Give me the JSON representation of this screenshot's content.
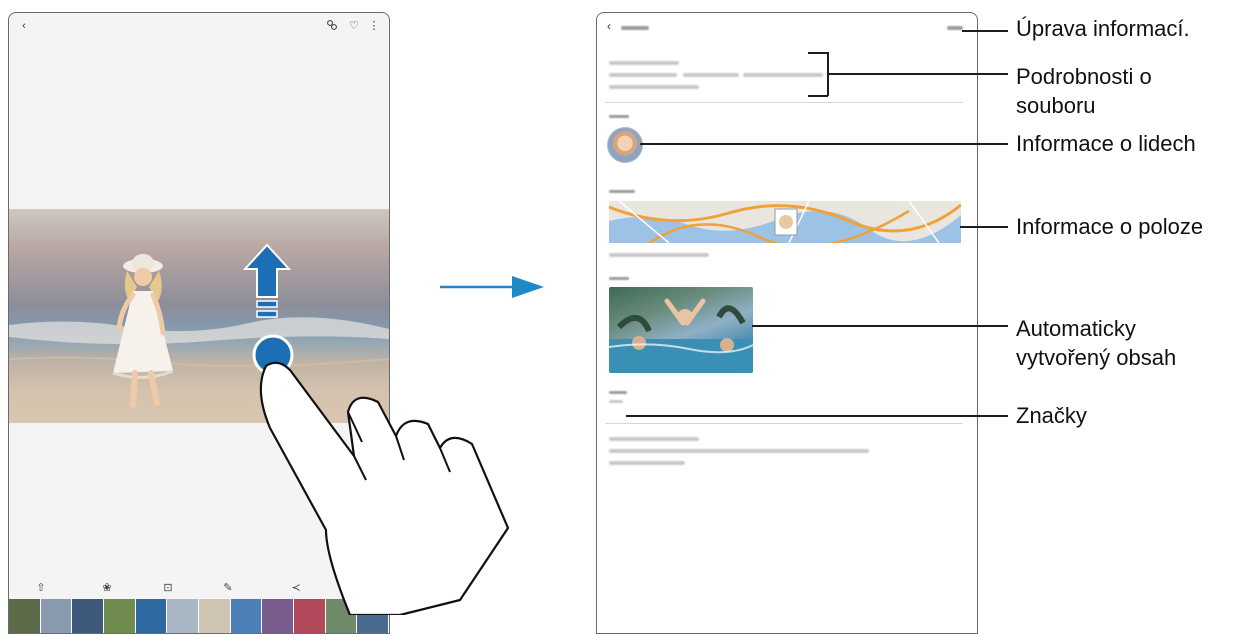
{
  "callouts": {
    "edit_info": "Úprava informací.",
    "file_details_line1": "Podrobnosti o",
    "file_details_line2": "souboru",
    "people_info": "Informace o lidech",
    "location_info": "Informace o poloze",
    "auto_content_line1": "Automaticky",
    "auto_content_line2": "vytvořený obsah",
    "tags": "Značky"
  },
  "left_screen": {
    "topbar_icons": [
      "back-icon",
      "bixby-vision-icon",
      "heart-icon",
      "more-options-icon"
    ],
    "toolbar_icons": [
      "share-icon",
      "filter-icon",
      "crop-icon",
      "draw-icon",
      "send-icon",
      "delete-icon"
    ]
  },
  "colors": {
    "accent_blue": "#1e88c8",
    "touch_blue": "#1c6fb4",
    "frame_gray": "#6b6b6b",
    "callout_line": "#1d1d1d"
  }
}
